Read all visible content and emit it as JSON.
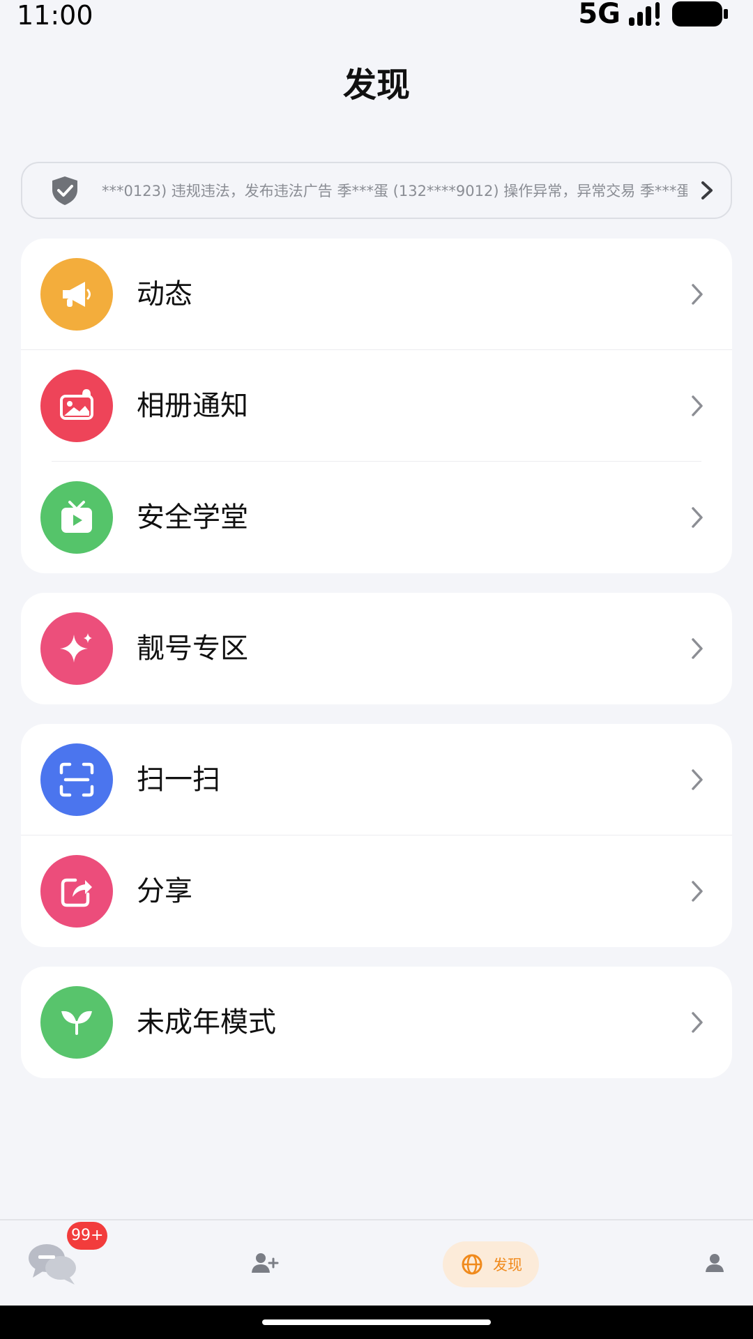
{
  "status": {
    "time": "11:00",
    "network": "5G"
  },
  "header": {
    "title": "发现"
  },
  "notice": {
    "text": "***0123) 违规违法，发布违法广告   季***蛋 (132****9012) 操作异常，异常交易   季***蛋",
    "icon": "shield-check-icon"
  },
  "groups": [
    {
      "items": [
        {
          "label": "动态",
          "icon": "megaphone-icon",
          "color": "#f3ad3c"
        },
        {
          "label": "相册通知",
          "icon": "album-notify-icon",
          "color": "#ee4459"
        },
        {
          "label": "安全学堂",
          "icon": "tv-play-icon",
          "color": "#55c46a"
        }
      ]
    },
    {
      "items": [
        {
          "label": "靓号专区",
          "icon": "sparkle-icon",
          "color": "#ec4f7b"
        }
      ]
    },
    {
      "items": [
        {
          "label": "扫一扫",
          "icon": "scan-icon",
          "color": "#4b75ee"
        },
        {
          "label": "分享",
          "icon": "share-icon",
          "color": "#ec4d7b"
        }
      ]
    },
    {
      "items": [
        {
          "label": "未成年模式",
          "icon": "sprout-icon",
          "color": "#58c46c"
        }
      ]
    }
  ],
  "tabbar": {
    "messages_badge": "99+",
    "active_label": "发现",
    "accent": "#f08a1c"
  }
}
